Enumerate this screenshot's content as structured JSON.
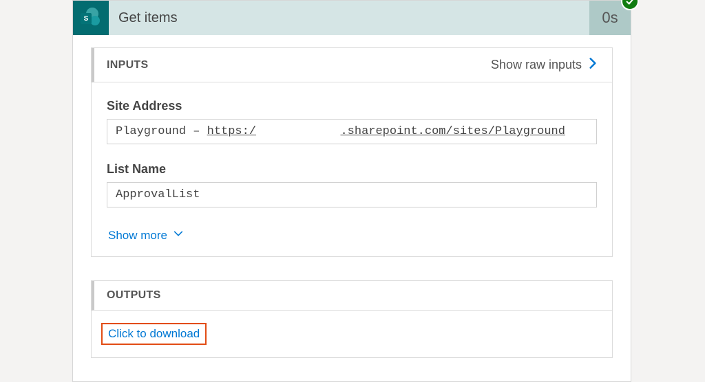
{
  "action": {
    "title": "Get items",
    "duration": "0s",
    "icon_letter": "S",
    "status": "success"
  },
  "inputs": {
    "section_label": "INPUTS",
    "raw_link": "Show raw inputs",
    "site_address_label": "Site Address",
    "site_address_prefix": "Playground – ",
    "site_address_url_a": "https:/",
    "site_address_url_b": ".sharepoint.com/sites/Playground",
    "list_name_label": "List Name",
    "list_name_value": "ApprovalList",
    "show_more": "Show more"
  },
  "outputs": {
    "section_label": "OUTPUTS",
    "download": "Click to download"
  }
}
